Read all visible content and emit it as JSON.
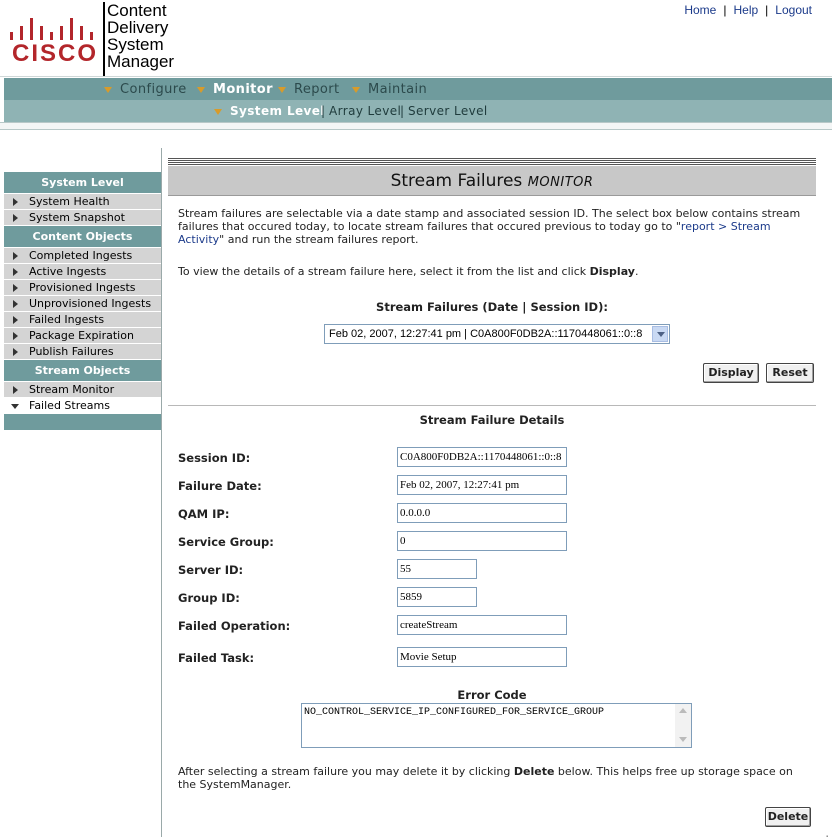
{
  "header": {
    "brand": "CISCO",
    "product_lines": [
      "Content",
      "Delivery",
      "System",
      "Manager"
    ],
    "links": {
      "home": "Home",
      "help": "Help",
      "logout": "Logout"
    }
  },
  "nav": {
    "primary": [
      "Configure",
      "Monitor",
      "Report",
      "Maintain"
    ],
    "secondary": [
      "System Level",
      "Array Level",
      "Server Level"
    ]
  },
  "sidebar": {
    "system_level": {
      "title": "System Level",
      "items": [
        "System Health",
        "System Snapshot"
      ]
    },
    "content_objects": {
      "title": "Content Objects",
      "items": [
        "Completed Ingests",
        "Active Ingests",
        "Provisioned Ingests",
        "Unprovisioned Ingests",
        "Failed Ingests",
        "Package Expiration",
        "Publish Failures"
      ]
    },
    "stream_objects": {
      "title": "Stream Objects",
      "items": [
        "Stream Monitor",
        "Failed Streams"
      ]
    }
  },
  "page": {
    "title": "Stream Failures",
    "subtitle": "Monitor",
    "intro_text": "Stream failures are selectable via a date stamp and associated session ID. The select box below contains stream failures that occured today, to locate stream failures that occured previous to today go to \"",
    "intro_link": "report > Stream Activity",
    "intro_tail": "\" and run the stream failures report.",
    "view_text": "To view the details of a stream failure here, select it from the list and click ",
    "view_bold": "Display",
    "view_tail": ".",
    "select_label": "Stream Failures (Date | Session ID):",
    "select_value": "Feb 02, 2007, 12:27:41 pm | C0A800F0DB2A::1170448061::0::8",
    "display_button": "Display",
    "reset_button": "Reset",
    "details_title": "Stream Failure Details",
    "fields": {
      "session_id": {
        "label": "Session ID:",
        "value": "C0A800F0DB2A::1170448061::0::8"
      },
      "failure_date": {
        "label": "Failure Date:",
        "value": "Feb 02, 2007, 12:27:41 pm"
      },
      "qam_ip": {
        "label": "QAM IP:",
        "value": "0.0.0.0"
      },
      "service_group": {
        "label": "Service Group:",
        "value": "0"
      },
      "server_id": {
        "label": "Server ID:",
        "value": "55"
      },
      "group_id": {
        "label": "Group ID:",
        "value": "5859"
      },
      "failed_operation": {
        "label": "Failed Operation:",
        "value": "createStream"
      },
      "failed_task": {
        "label": "Failed Task:",
        "value": "Movie Setup"
      }
    },
    "error_title": "Error Code",
    "error_value": "NO_CONTROL_SERVICE_IP_CONFIGURED_FOR_SERVICE_GROUP",
    "delete_text": "After selecting a stream failure you may delete it by clicking ",
    "delete_bold": "Delete",
    "delete_tail": " below. This helps free up storage space on the SystemManager.",
    "delete_button": "Delete"
  },
  "figure_id": "203431",
  "colors": {
    "nav_dark": "#6f9b9d",
    "nav_light": "#8fb3b4",
    "brand_red": "#b3262b",
    "link": "#1b3a8a",
    "accent_bullet": "#d89b2a"
  }
}
